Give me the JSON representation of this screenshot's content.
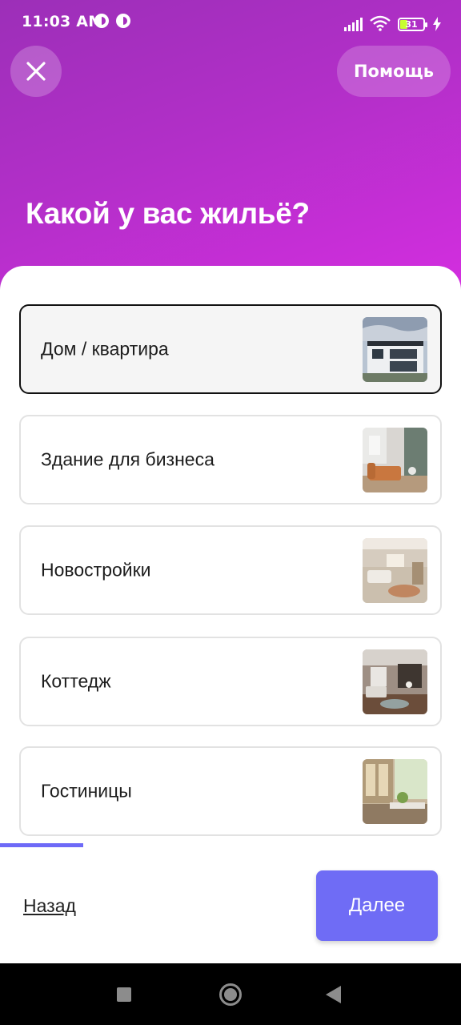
{
  "status_bar": {
    "time": "11:03 AM",
    "battery_level": "31",
    "battery_fraction": 0.31
  },
  "header": {
    "help_label": "Помощь",
    "title": "Какой у вас жильё?"
  },
  "options": [
    {
      "label": "Дом / квартира",
      "selected": true
    },
    {
      "label": "Здание для бизнеса",
      "selected": false
    },
    {
      "label": "Новостройки",
      "selected": false
    },
    {
      "label": "Коттедж",
      "selected": false
    },
    {
      "label": "Гостиницы",
      "selected": false
    }
  ],
  "progress_fraction": 0.18,
  "footer": {
    "back_label": "Назад",
    "next_label": "Далее"
  },
  "colors": {
    "header_gradient_start": "#9c2fb8",
    "header_gradient_end": "#d42ee0",
    "accent": "#6f6cf5",
    "selected_border": "#111111"
  },
  "icons": [
    "close-icon",
    "signal-icon",
    "wifi-icon",
    "battery-icon",
    "charging-icon",
    "recent-apps-icon",
    "home-icon",
    "back-icon"
  ]
}
